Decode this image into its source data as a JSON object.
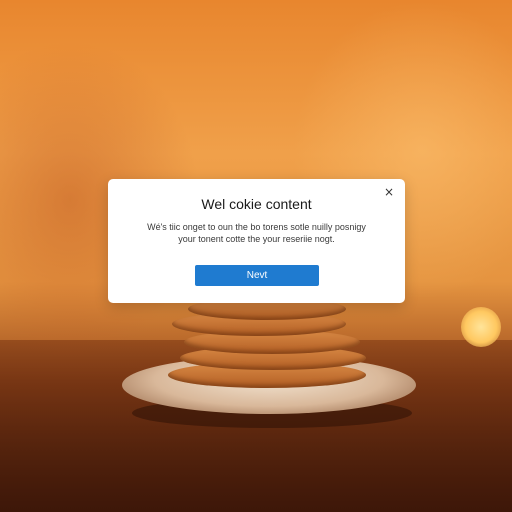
{
  "background": {
    "scene": "blurred stack of cookies on a plate in warm orange light",
    "accent_color": "#e8862e"
  },
  "modal": {
    "title": "Wel cokie content",
    "body": "Wé's tiic onget to oun the bo torens sotle nuilly posnigy your tonent cotte the your reseriie nogt.",
    "close_icon": "close-icon",
    "close_glyph": "×",
    "button_label": "Nevt",
    "button_color": "#1f7bd0"
  }
}
